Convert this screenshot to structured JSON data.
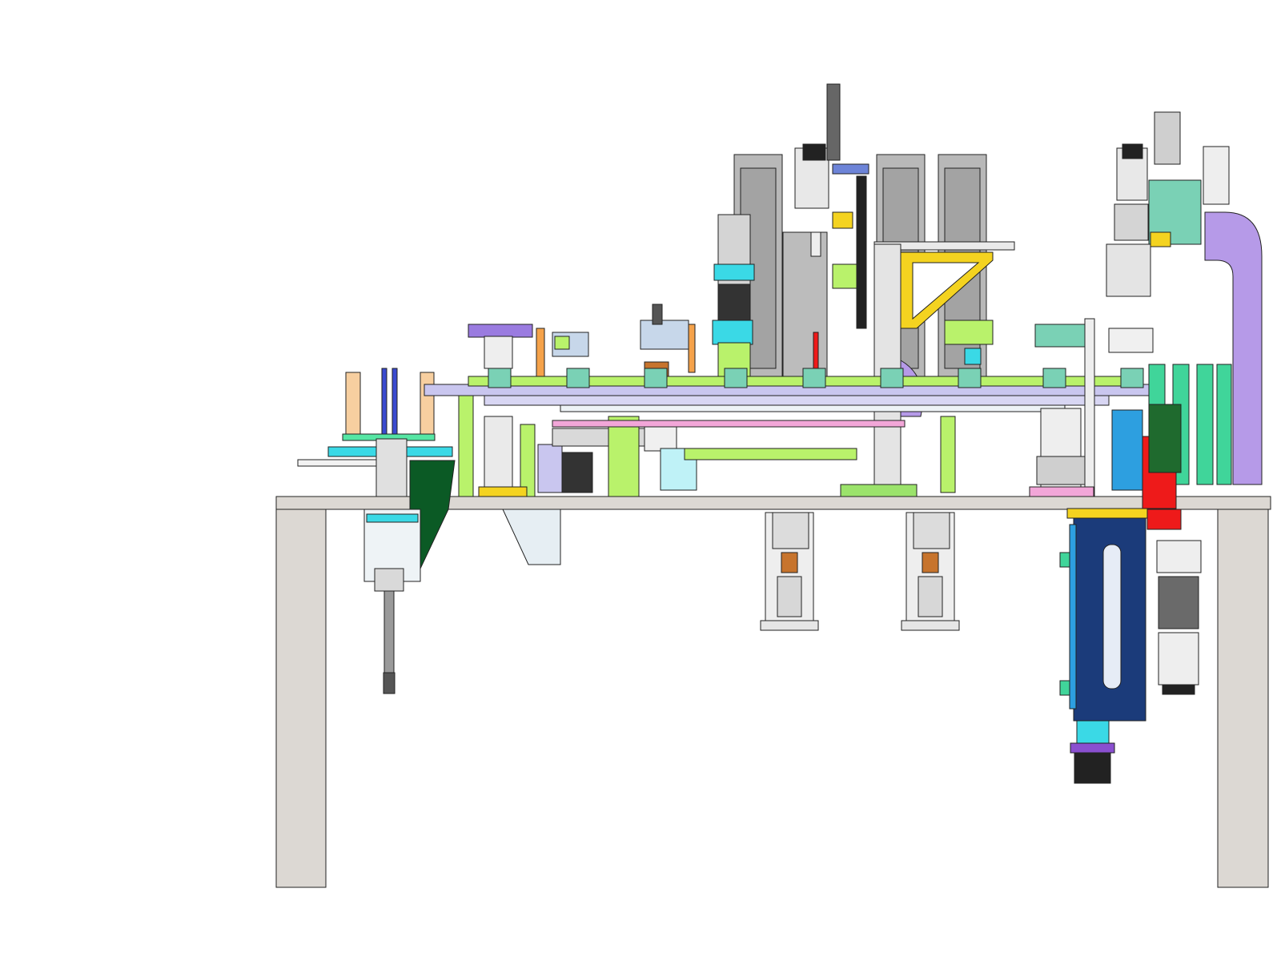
{
  "drawing": {
    "subject": "",
    "view": ""
  },
  "colors": {
    "background": "#ffffff",
    "table": "#dcd8d3",
    "tower_grey": "#b8b8b8",
    "tower_dark": "#8e8e8e",
    "lavender": "#c9c6ef",
    "purple_arm": "#b69ae8",
    "lime": "#b9f26b",
    "cyan": "#3ad9e6",
    "teal_green": "#40d59a",
    "yellow": "#f4d320",
    "red": "#ee1a1a",
    "navy": "#1b3b7a",
    "dark_green": "#0b5a25",
    "orange": "#f5a24a",
    "pink": "#f2a6d8",
    "steel_blue": "#2d9fe0"
  }
}
